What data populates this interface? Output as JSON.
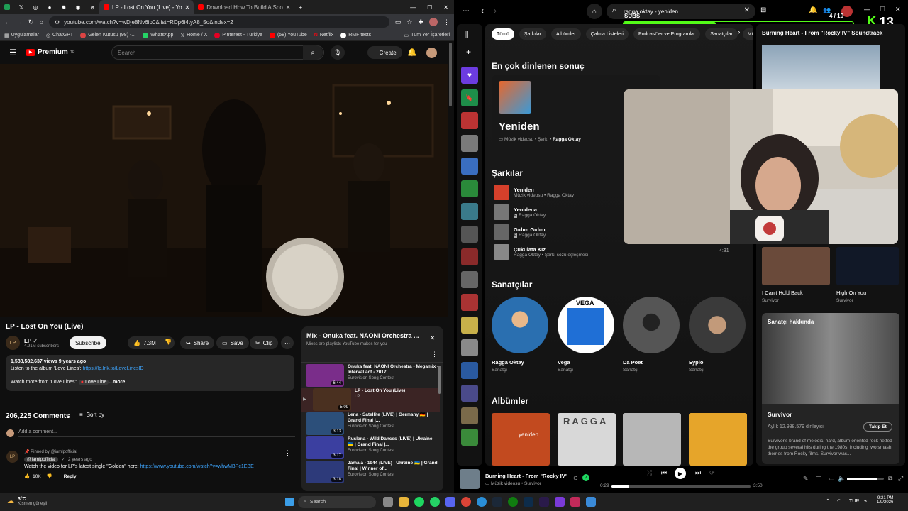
{
  "browser": {
    "tabs": [
      {
        "label": "LP - Lost On You (Live) - Yo",
        "active": true
      },
      {
        "label": "Download How To Build A Sno",
        "active": false
      }
    ],
    "url": "youtube.com/watch?v=wDje8Nv6ip0&list=RDp6i4tyA8_5o&index=2",
    "bookmarks": [
      "Uygulamalar",
      "ChatGPT",
      "Gelen Kutusu (98) -...",
      "WhatsApp",
      "Home / X",
      "Pinterest - Türkiye",
      "(58) YouTube",
      "Netflix",
      "RMF tests"
    ],
    "bookmarks_all": "Tüm Yer İşaretleri"
  },
  "youtube": {
    "brand": "Premium",
    "brand_sup": "TR",
    "search_placeholder": "Search",
    "create_label": "Create",
    "video_title": "LP - Lost On You (Live)",
    "channel": "LP",
    "subscribers": "4.91M subscribers",
    "subscribe_label": "Subscribe",
    "likes": "7.3M",
    "share_label": "Share",
    "save_label": "Save",
    "clip_label": "Clip",
    "desc_stats": "1,588,582,637 views  9 years ago",
    "desc_line1_text": "Listen to the album 'Love Lines': ",
    "desc_line1_link": "https://lp.lnk.to/LoveLinesID",
    "desc_line2": "Watch more from 'Love Lines':",
    "desc_chip": "Love Line",
    "desc_more": "...more",
    "comments_count": "206,225 Comments",
    "sort_label": "Sort by",
    "add_comment": "Add a comment...",
    "comment": {
      "pinned": "Pinned by @iamlpofficial",
      "author": "@iamlpofficial",
      "time": "2 years ago",
      "text": "Watch the video for LP's latest single \"Golden\" here: ",
      "link": "https://www.youtube.com/watch?v=whwMBPc1EBE",
      "likes": "10K",
      "reply": "Reply"
    },
    "playlist": {
      "title": "Mix - Onuka feat. NAONI Orchestra ...",
      "subtitle": "Mixes are playlists YouTube makes for you",
      "items": [
        {
          "title": "Onuka feat. NAONI Orchestra - Megamix - Interval act - 2017...",
          "channel": "Eurovision Song Contest",
          "duration": "6:44",
          "color": "#7a2d8a"
        },
        {
          "title": "LP - Lost On You (Live)",
          "channel": "LP",
          "duration": "5:09",
          "color": "#4a3020"
        },
        {
          "title": "Lena - Satellite (LIVE) | Germany 🇩🇪 | Grand Final |...",
          "channel": "Eurovision Song Contest",
          "duration": "3:13",
          "color": "#2c4f7a"
        },
        {
          "title": "Ruslana - Wild Dances (LIVE) | Ukraine 🇺🇦 | Grand Final |...",
          "channel": "Eurovision Song Contest",
          "duration": "3:17",
          "color": "#3b3fa0"
        },
        {
          "title": "Jamala - 1944 (LIVE) | Ukraine 🇺🇦 | Grand Final | Winner of...",
          "channel": "Eurovision Song Contest",
          "duration": "3:18",
          "color": "#2d3a7a"
        }
      ]
    }
  },
  "spotify": {
    "search_value": "ragga oktay - yeniden",
    "subs_label": "SUBS",
    "subs_count": "4 / 10",
    "subs_progress": 0.4,
    "k_badge": "13",
    "chips": [
      "Tümü",
      "Şarkılar",
      "Albümler",
      "Çalma Listeleri",
      "Podcast'ler ve Programlar",
      "Sanatçılar",
      "Mü"
    ],
    "top_result_heading": "En çok dinlenen sonuç",
    "top_result": {
      "title": "Yeniden",
      "type": "Müzik videosu",
      "sep": "Şarkı",
      "artist": "Ragga Oktay"
    },
    "songs_heading": "Şarkılar",
    "songs": [
      {
        "title": "Yeniden",
        "sub": "Müzik videosu • Ragga Oktay",
        "color": "#d6402b"
      },
      {
        "title": "Yenidena",
        "sub": "Ragga Oktay",
        "color": "#777"
      },
      {
        "title": "Gıdım Gıdım",
        "sub": "Ragga Oktay",
        "color": "#666"
      },
      {
        "title": "Çukulata Kız",
        "sub": "Ragga Oktay • Şarkı sözü eşleşmesi",
        "color": "#888"
      }
    ],
    "song_duration": "4:31",
    "artists_heading": "Sanatçılar",
    "artists": [
      {
        "name": "Ragga Oktay",
        "role": "Sanatçı",
        "color": "#2a6fb0"
      },
      {
        "name": "Vega",
        "role": "Sanatçı",
        "color": "#1f6fd6",
        "logo": "VEGA"
      },
      {
        "name": "Da Poet",
        "role": "Sanatçı",
        "color": "#555"
      },
      {
        "name": "Eypio",
        "role": "Sanatçı",
        "color": "#3a3a3a"
      }
    ],
    "albums_heading": "Albümler",
    "albums": [
      {
        "color": "#c24a1f",
        "label": "yeniden"
      },
      {
        "color": "#d8d8d8",
        "label": "RAGGA"
      },
      {
        "color": "#b7b7b7",
        "label": ""
      },
      {
        "color": "#e6a52a",
        "label": ""
      }
    ],
    "now_playing_panel": {
      "title": "Burning Heart - From \"Rocky IV\" Soundtrack"
    },
    "related": [
      {
        "title": "I Can't Hold Back",
        "artist": "Survivor"
      },
      {
        "title": "High On You",
        "artist": "Survivor"
      }
    ],
    "about": {
      "heading": "Sanatçı hakkında",
      "artist": "Survivor",
      "listeners": "Aylık 12.988.579 dinleyici",
      "follow": "Takip Et",
      "bio": "Survivor's brand of melodic, hard, album-oriented rock netted the group several hits during the 1980s, including two smash themes from Rocky films. Survivor was..."
    },
    "player": {
      "title": "Burning Heart - From \"Rocky IV\" Sou",
      "sub": "Müzik videosu • Survivor",
      "elapsed": "0:29",
      "total": "3:50",
      "progress": 0.126
    }
  },
  "taskbar": {
    "weather_temp": "3°C",
    "weather_desc": "Kısmen güneşli",
    "search": "Search",
    "lang": "TUR",
    "time": "9:21 PM",
    "date": "1/9/2026"
  }
}
